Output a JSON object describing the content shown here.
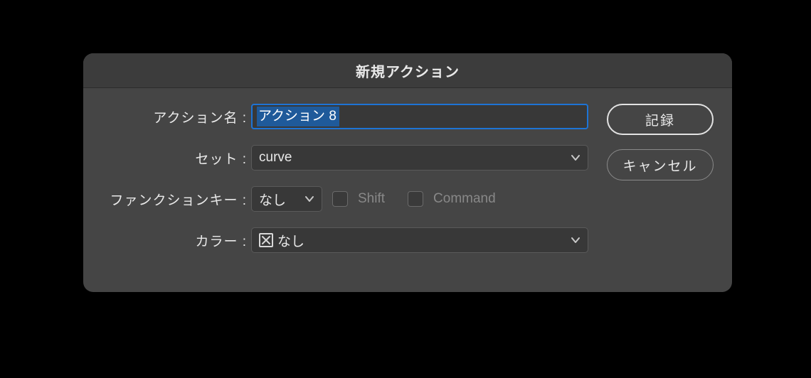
{
  "dialog": {
    "title": "新規アクション",
    "labels": {
      "action_name": "アクション名 :",
      "set": "セット :",
      "function_key": "ファンクションキー :",
      "color": "カラー :"
    },
    "fields": {
      "action_name_value": "アクション 8",
      "set_value": "curve",
      "function_key_value": "なし",
      "shift_label": "Shift",
      "command_label": "Command",
      "shift_checked": false,
      "command_checked": false,
      "color_value": "なし"
    },
    "buttons": {
      "record": "記録",
      "cancel": "キャンセル"
    }
  }
}
